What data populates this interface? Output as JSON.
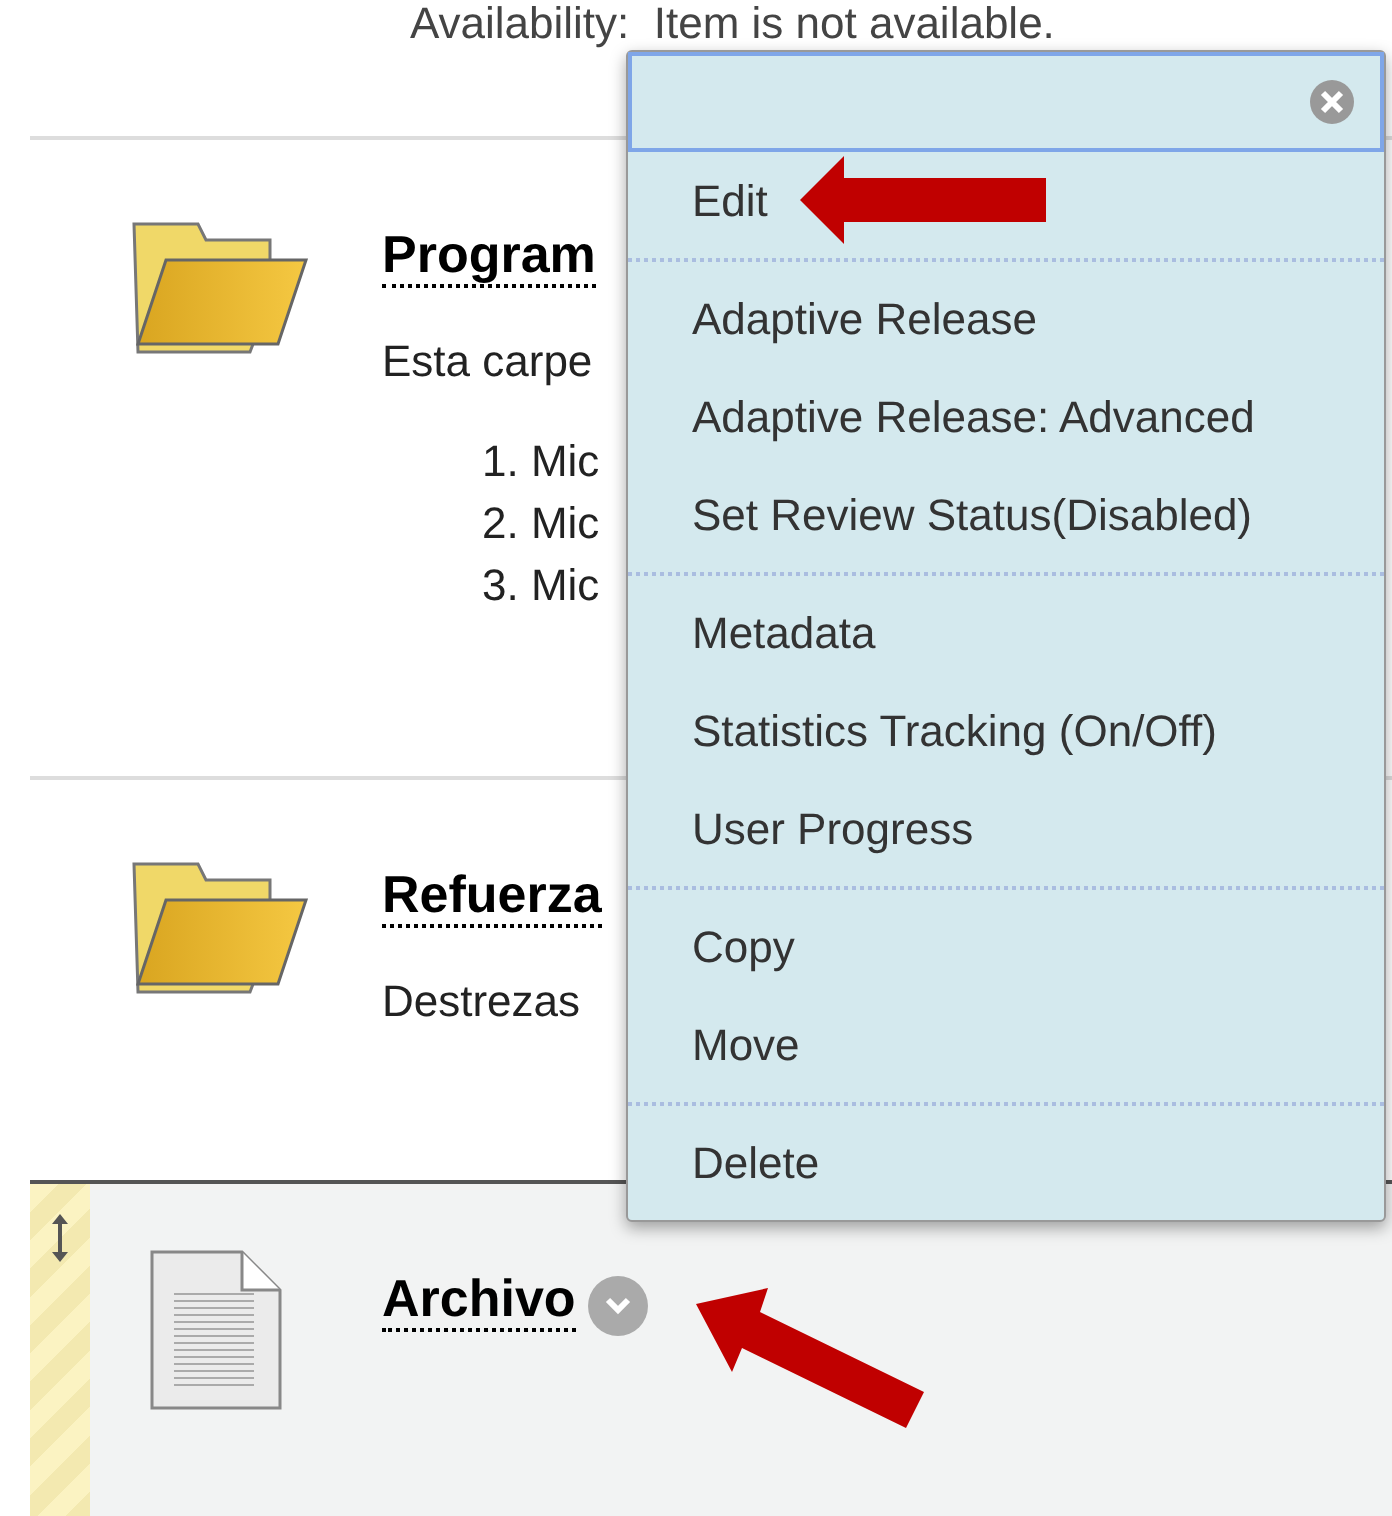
{
  "availability": "Availability:  Item is not available.",
  "items": [
    {
      "kind": "folder",
      "title": "Program",
      "description": "Esta carpe",
      "list": [
        "1. Mic",
        "2. Mic",
        "3. Mic"
      ]
    },
    {
      "kind": "folder",
      "title": "Refuerza",
      "description": "Destrezas"
    },
    {
      "kind": "file",
      "title": "Archivo",
      "draggable": true
    }
  ],
  "menu": {
    "groups": [
      [
        "Edit"
      ],
      [
        "Adaptive Release",
        "Adaptive Release: Advanced",
        "Set Review Status(Disabled)"
      ],
      [
        "Metadata",
        "Statistics Tracking (On/Off)",
        "User Progress"
      ],
      [
        "Copy",
        "Move"
      ],
      [
        "Delete"
      ]
    ]
  }
}
